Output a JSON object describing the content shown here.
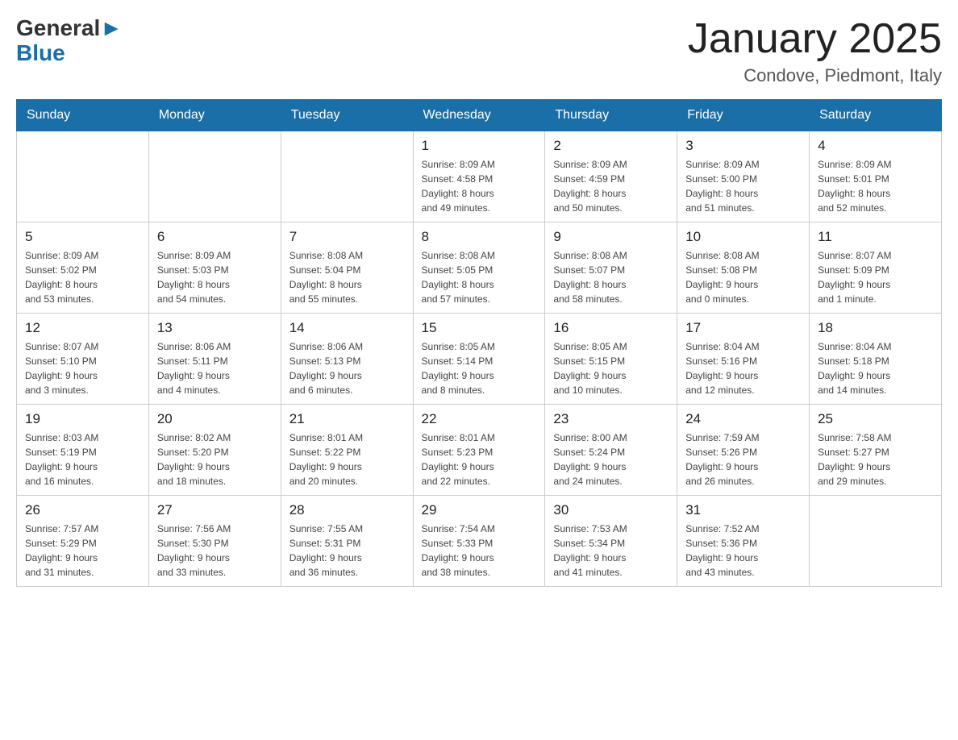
{
  "logo": {
    "general": "General",
    "blue": "Blue",
    "arrow": "▶"
  },
  "title": "January 2025",
  "subtitle": "Condove, Piedmont, Italy",
  "weekdays": [
    "Sunday",
    "Monday",
    "Tuesday",
    "Wednesday",
    "Thursday",
    "Friday",
    "Saturday"
  ],
  "weeks": [
    [
      {
        "day": "",
        "info": ""
      },
      {
        "day": "",
        "info": ""
      },
      {
        "day": "",
        "info": ""
      },
      {
        "day": "1",
        "info": "Sunrise: 8:09 AM\nSunset: 4:58 PM\nDaylight: 8 hours\nand 49 minutes."
      },
      {
        "day": "2",
        "info": "Sunrise: 8:09 AM\nSunset: 4:59 PM\nDaylight: 8 hours\nand 50 minutes."
      },
      {
        "day": "3",
        "info": "Sunrise: 8:09 AM\nSunset: 5:00 PM\nDaylight: 8 hours\nand 51 minutes."
      },
      {
        "day": "4",
        "info": "Sunrise: 8:09 AM\nSunset: 5:01 PM\nDaylight: 8 hours\nand 52 minutes."
      }
    ],
    [
      {
        "day": "5",
        "info": "Sunrise: 8:09 AM\nSunset: 5:02 PM\nDaylight: 8 hours\nand 53 minutes."
      },
      {
        "day": "6",
        "info": "Sunrise: 8:09 AM\nSunset: 5:03 PM\nDaylight: 8 hours\nand 54 minutes."
      },
      {
        "day": "7",
        "info": "Sunrise: 8:08 AM\nSunset: 5:04 PM\nDaylight: 8 hours\nand 55 minutes."
      },
      {
        "day": "8",
        "info": "Sunrise: 8:08 AM\nSunset: 5:05 PM\nDaylight: 8 hours\nand 57 minutes."
      },
      {
        "day": "9",
        "info": "Sunrise: 8:08 AM\nSunset: 5:07 PM\nDaylight: 8 hours\nand 58 minutes."
      },
      {
        "day": "10",
        "info": "Sunrise: 8:08 AM\nSunset: 5:08 PM\nDaylight: 9 hours\nand 0 minutes."
      },
      {
        "day": "11",
        "info": "Sunrise: 8:07 AM\nSunset: 5:09 PM\nDaylight: 9 hours\nand 1 minute."
      }
    ],
    [
      {
        "day": "12",
        "info": "Sunrise: 8:07 AM\nSunset: 5:10 PM\nDaylight: 9 hours\nand 3 minutes."
      },
      {
        "day": "13",
        "info": "Sunrise: 8:06 AM\nSunset: 5:11 PM\nDaylight: 9 hours\nand 4 minutes."
      },
      {
        "day": "14",
        "info": "Sunrise: 8:06 AM\nSunset: 5:13 PM\nDaylight: 9 hours\nand 6 minutes."
      },
      {
        "day": "15",
        "info": "Sunrise: 8:05 AM\nSunset: 5:14 PM\nDaylight: 9 hours\nand 8 minutes."
      },
      {
        "day": "16",
        "info": "Sunrise: 8:05 AM\nSunset: 5:15 PM\nDaylight: 9 hours\nand 10 minutes."
      },
      {
        "day": "17",
        "info": "Sunrise: 8:04 AM\nSunset: 5:16 PM\nDaylight: 9 hours\nand 12 minutes."
      },
      {
        "day": "18",
        "info": "Sunrise: 8:04 AM\nSunset: 5:18 PM\nDaylight: 9 hours\nand 14 minutes."
      }
    ],
    [
      {
        "day": "19",
        "info": "Sunrise: 8:03 AM\nSunset: 5:19 PM\nDaylight: 9 hours\nand 16 minutes."
      },
      {
        "day": "20",
        "info": "Sunrise: 8:02 AM\nSunset: 5:20 PM\nDaylight: 9 hours\nand 18 minutes."
      },
      {
        "day": "21",
        "info": "Sunrise: 8:01 AM\nSunset: 5:22 PM\nDaylight: 9 hours\nand 20 minutes."
      },
      {
        "day": "22",
        "info": "Sunrise: 8:01 AM\nSunset: 5:23 PM\nDaylight: 9 hours\nand 22 minutes."
      },
      {
        "day": "23",
        "info": "Sunrise: 8:00 AM\nSunset: 5:24 PM\nDaylight: 9 hours\nand 24 minutes."
      },
      {
        "day": "24",
        "info": "Sunrise: 7:59 AM\nSunset: 5:26 PM\nDaylight: 9 hours\nand 26 minutes."
      },
      {
        "day": "25",
        "info": "Sunrise: 7:58 AM\nSunset: 5:27 PM\nDaylight: 9 hours\nand 29 minutes."
      }
    ],
    [
      {
        "day": "26",
        "info": "Sunrise: 7:57 AM\nSunset: 5:29 PM\nDaylight: 9 hours\nand 31 minutes."
      },
      {
        "day": "27",
        "info": "Sunrise: 7:56 AM\nSunset: 5:30 PM\nDaylight: 9 hours\nand 33 minutes."
      },
      {
        "day": "28",
        "info": "Sunrise: 7:55 AM\nSunset: 5:31 PM\nDaylight: 9 hours\nand 36 minutes."
      },
      {
        "day": "29",
        "info": "Sunrise: 7:54 AM\nSunset: 5:33 PM\nDaylight: 9 hours\nand 38 minutes."
      },
      {
        "day": "30",
        "info": "Sunrise: 7:53 AM\nSunset: 5:34 PM\nDaylight: 9 hours\nand 41 minutes."
      },
      {
        "day": "31",
        "info": "Sunrise: 7:52 AM\nSunset: 5:36 PM\nDaylight: 9 hours\nand 43 minutes."
      },
      {
        "day": "",
        "info": ""
      }
    ]
  ]
}
